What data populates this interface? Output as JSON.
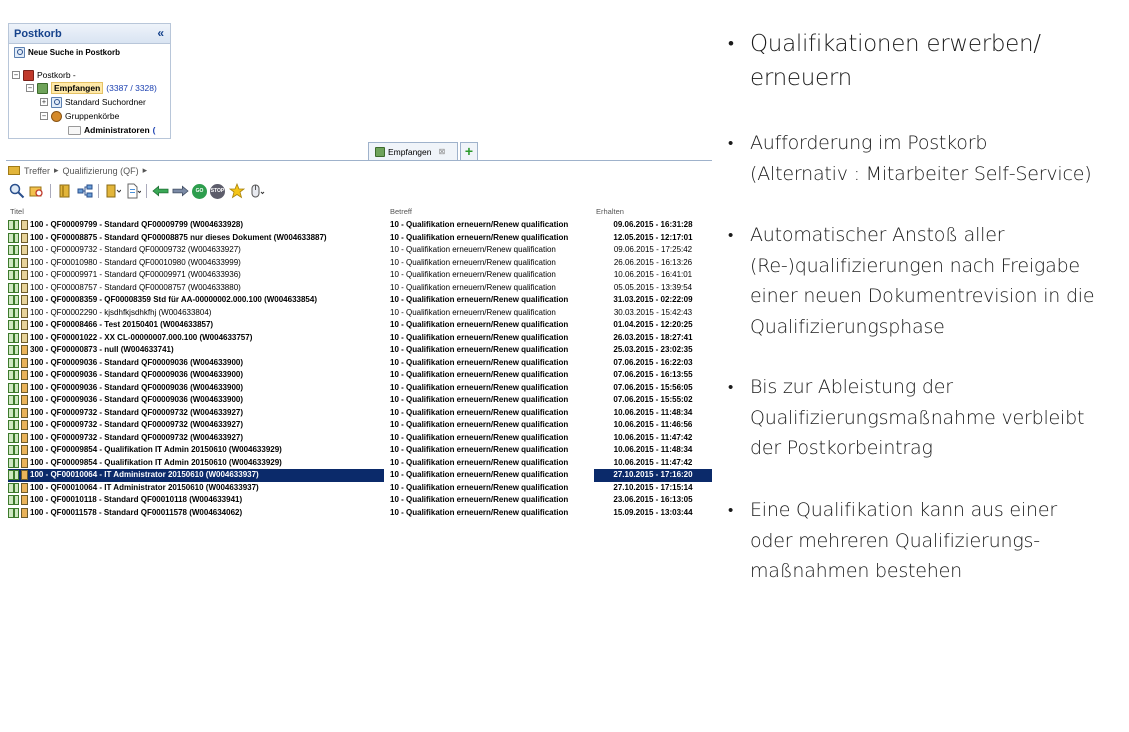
{
  "postkorb": {
    "title": "Postkorb",
    "collapse_icon": "«",
    "new_search": "Neue Suche in Postkorb",
    "tree": {
      "root": "Postkorb -",
      "inbox": "Empfangen",
      "inbox_count": "(3387 / 3328)",
      "standard_folder": "Standard Suchordner",
      "group_boxes": "Gruppenkörbe",
      "admin": "Administratoren",
      "admin_suffix": "("
    }
  },
  "tabs": {
    "active": "Empfangen",
    "close_icon": "⊠",
    "add_icon": "+"
  },
  "breadcrumb": {
    "items": [
      "Treffer",
      "Qualifizierung (QF)"
    ],
    "separator": "▸"
  },
  "toolbar": {
    "stop_label": "STOP",
    "go_label": "GO"
  },
  "columns": {
    "title": "Titel",
    "subject": "Betreff",
    "received": "Erhalten"
  },
  "rows": [
    {
      "title": "100 - QF00009799 - Standard QF00009799 (W004633928)",
      "subject": "10 - Qualifikation erneuern/Renew qualification",
      "received": "09.06.2015 - 16:31:28",
      "bold": true,
      "icon": "single"
    },
    {
      "title": "100 - QF00008875 - Standard QF00008875 nur dieses Dokument (W004633887)",
      "subject": "10 - Qualifikation erneuern/Renew qualification",
      "received": "12.05.2015 - 12:17:01",
      "bold": true,
      "icon": "single"
    },
    {
      "title": "100 - QF00009732 - Standard QF00009732 (W004633927)",
      "subject": "10 - Qualifikation erneuern/Renew qualification",
      "received": "09.06.2015 - 17:25:42",
      "bold": false,
      "icon": "single"
    },
    {
      "title": "100 - QF00010980 - Standard QF00010980 (W004633999)",
      "subject": "10 - Qualifikation erneuern/Renew qualification",
      "received": "26.06.2015 - 16:13:26",
      "bold": false,
      "icon": "single"
    },
    {
      "title": "100 - QF00009971 - Standard QF00009971 (W004633936)",
      "subject": "10 - Qualifikation erneuern/Renew qualification",
      "received": "10.06.2015 - 16:41:01",
      "bold": false,
      "icon": "single"
    },
    {
      "title": "100 - QF00008757 - Standard QF00008757 (W004633880)",
      "subject": "10 - Qualifikation erneuern/Renew qualification",
      "received": "05.05.2015 - 13:39:54",
      "bold": false,
      "icon": "single"
    },
    {
      "title": "100 - QF00008359 - QF00008359 Std für AA-00000002.000.100 (W004633854)",
      "subject": "10 - Qualifikation erneuern/Renew qualification",
      "received": "31.03.2015 - 02:22:09",
      "bold": true,
      "icon": "single"
    },
    {
      "title": "100 - QF00002290 - kjsdhfkjsdhkfhj (W004633804)",
      "subject": "10 - Qualifikation erneuern/Renew qualification",
      "received": "30.03.2015 - 15:42:43",
      "bold": false,
      "icon": "single"
    },
    {
      "title": "100 - QF00008466 - Test 20150401 (W004633857)",
      "subject": "10 - Qualifikation erneuern/Renew qualification",
      "received": "01.04.2015 - 12:20:25",
      "bold": true,
      "icon": "single"
    },
    {
      "title": "100 - QF00001022 - XX CL-00000007.000.100 (W004633757)",
      "subject": "10 - Qualifikation erneuern/Renew qualification",
      "received": "26.03.2015 - 18:27:41",
      "bold": true,
      "icon": "single"
    },
    {
      "title": "300 - QF00000873 - null (W004633741)",
      "subject": "10 - Qualifikation erneuern/Renew qualification",
      "received": "25.03.2015 - 23:02:35",
      "bold": true,
      "icon": "group"
    },
    {
      "title": "100 - QF00009036 - Standard QF00009036 (W004633900)",
      "subject": "10 - Qualifikation erneuern/Renew qualification",
      "received": "07.06.2015 - 16:22:03",
      "bold": true,
      "icon": "group"
    },
    {
      "title": "100 - QF00009036 - Standard QF00009036 (W004633900)",
      "subject": "10 - Qualifikation erneuern/Renew qualification",
      "received": "07.06.2015 - 16:13:55",
      "bold": true,
      "icon": "group"
    },
    {
      "title": "100 - QF00009036 - Standard QF00009036 (W004633900)",
      "subject": "10 - Qualifikation erneuern/Renew qualification",
      "received": "07.06.2015 - 15:56:05",
      "bold": true,
      "icon": "group"
    },
    {
      "title": "100 - QF00009036 - Standard QF00009036 (W004633900)",
      "subject": "10 - Qualifikation erneuern/Renew qualification",
      "received": "07.06.2015 - 15:55:02",
      "bold": true,
      "icon": "group"
    },
    {
      "title": "100 - QF00009732 - Standard QF00009732 (W004633927)",
      "subject": "10 - Qualifikation erneuern/Renew qualification",
      "received": "10.06.2015 - 11:48:34",
      "bold": true,
      "icon": "group"
    },
    {
      "title": "100 - QF00009732 - Standard QF00009732 (W004633927)",
      "subject": "10 - Qualifikation erneuern/Renew qualification",
      "received": "10.06.2015 - 11:46:56",
      "bold": true,
      "icon": "group"
    },
    {
      "title": "100 - QF00009732 - Standard QF00009732 (W004633927)",
      "subject": "10 - Qualifikation erneuern/Renew qualification",
      "received": "10.06.2015 - 11:47:42",
      "bold": true,
      "icon": "group"
    },
    {
      "title": "100 - QF00009854 - Qualifikation IT Admin 20150610 (W004633929)",
      "subject": "10 - Qualifikation erneuern/Renew qualification",
      "received": "10.06.2015 - 11:48:34",
      "bold": true,
      "icon": "group"
    },
    {
      "title": "100 - QF00009854 - Qualifikation IT Admin 20150610 (W004633929)",
      "subject": "10 - Qualifikation erneuern/Renew qualification",
      "received": "10.06.2015 - 11:47:42",
      "bold": true,
      "icon": "group"
    },
    {
      "title": "100 - QF00010064 - IT Administrator 20150610 (W004633937)",
      "subject": "10 - Qualifikation erneuern/Renew qualification",
      "received": "27.10.2015 - 17:16:20",
      "bold": true,
      "icon": "group",
      "selected": true
    },
    {
      "title": "100 - QF00010064 - IT Administrator 20150610 (W004633937)",
      "subject": "10 - Qualifikation erneuern/Renew qualification",
      "received": "27.10.2015 - 17:15:14",
      "bold": true,
      "icon": "group"
    },
    {
      "title": "100 - QF00010118 - Standard QF00010118 (W004633941)",
      "subject": "10 - Qualifikation erneuern/Renew qualification",
      "received": "23.06.2015 - 16:13:05",
      "bold": true,
      "icon": "group"
    },
    {
      "title": "100 - QF00011578 - Standard QF00011578 (W004634062)",
      "subject": "10 - Qualifikation erneuern/Renew qualification",
      "received": "15.09.2015 - 13:03:44",
      "bold": true,
      "icon": "group"
    }
  ],
  "bullets": {
    "marker": "•",
    "b1": [
      "Qualifikationen erwerben/",
      "erneuern"
    ],
    "b2": [
      "Aufforderung im Postkorb",
      "(Alternativ : Mitarbeiter Self-Service)"
    ],
    "b3": [
      "Automatischer Anstoß aller",
      "(Re-)qualifizierungen nach Freigabe",
      "einer neuen Dokumentrevision in die",
      "Qualifizierungsphase"
    ],
    "b4": [
      "Bis zur Ableistung der",
      "Qualifizierungsmaßnahme verbleibt",
      "der Postkorbeintrag"
    ],
    "b5": [
      "Eine Qualifikation kann aus einer",
      "oder mehreren Qualifizierungs-",
      "maßnahmen bestehen"
    ]
  }
}
